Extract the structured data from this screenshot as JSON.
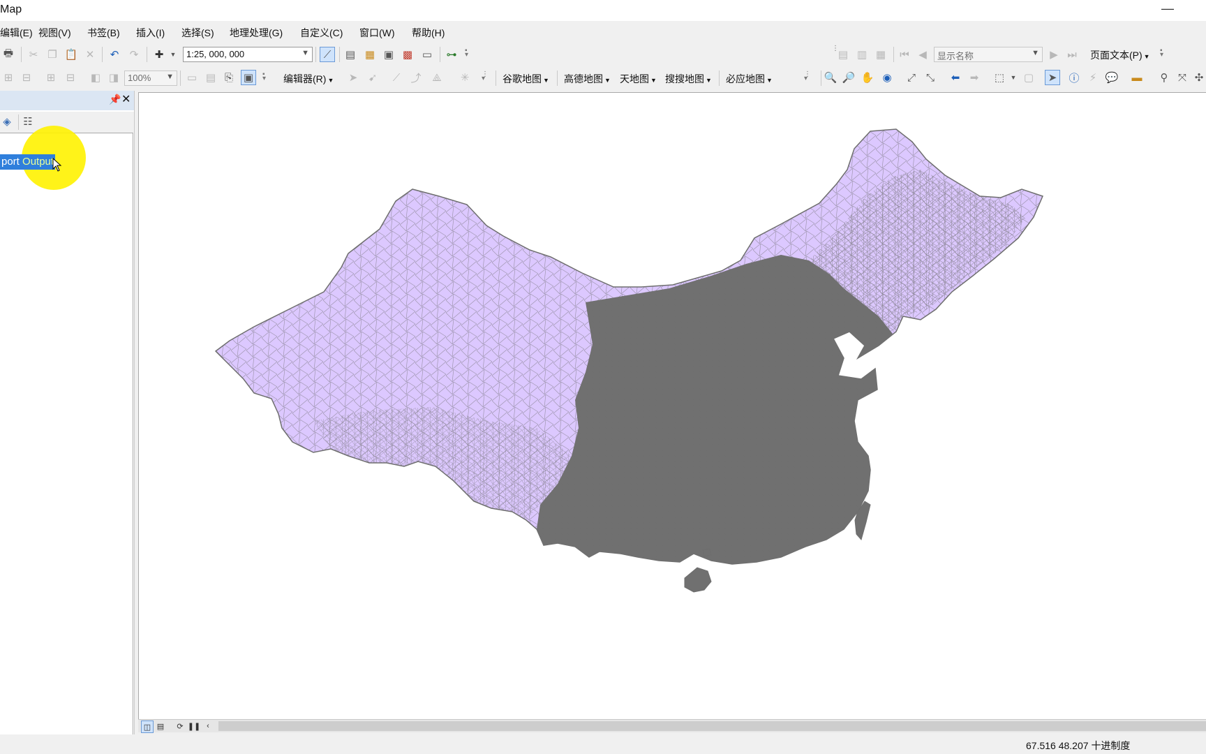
{
  "window": {
    "title": "Map",
    "minimize_glyph": "—"
  },
  "menu": [
    {
      "label": "编辑(E)"
    },
    {
      "label": "视图(V)"
    },
    {
      "label": "书签(B)"
    },
    {
      "label": "插入(I)"
    },
    {
      "label": "选择(S)"
    },
    {
      "label": "地理处理(G)"
    },
    {
      "label": "自定义(C)"
    },
    {
      "label": "窗口(W)"
    },
    {
      "label": "帮助(H)"
    }
  ],
  "standard_toolbar": {
    "scale_value": "1:25, 000, 000",
    "icons": [
      "print-icon",
      "cut-icon",
      "copy-icon",
      "paste-icon",
      "delete-icon",
      "undo-icon",
      "redo-icon",
      "add-data-icon",
      "editor-toolbar-icon",
      "table-icon",
      "catalog-icon",
      "search-window-icon",
      "arctoolbox-icon",
      "python-icon",
      "model-builder-icon"
    ]
  },
  "layout_toolbar": {
    "zoom_value": "100%",
    "display_name_value": "显示名称",
    "page_text_label": "页面文本(P)"
  },
  "editor_toolbar": {
    "label": "编辑器(R)"
  },
  "basemap_plugins": [
    {
      "label": "谷歌地图"
    },
    {
      "label": "高德地图"
    },
    {
      "label": "天地图"
    },
    {
      "label": "搜搜地图"
    },
    {
      "label": "必应地图"
    }
  ],
  "toc": {
    "layer_label_a": "port",
    "layer_label_b": " Output"
  },
  "map": {
    "fill_color": "#dcc8ff",
    "edge_color": "#6e6e6e",
    "dense_color": "#6a6a6a"
  },
  "status": {
    "x": "67.516",
    "y": "48.207",
    "units": "十进制度"
  }
}
